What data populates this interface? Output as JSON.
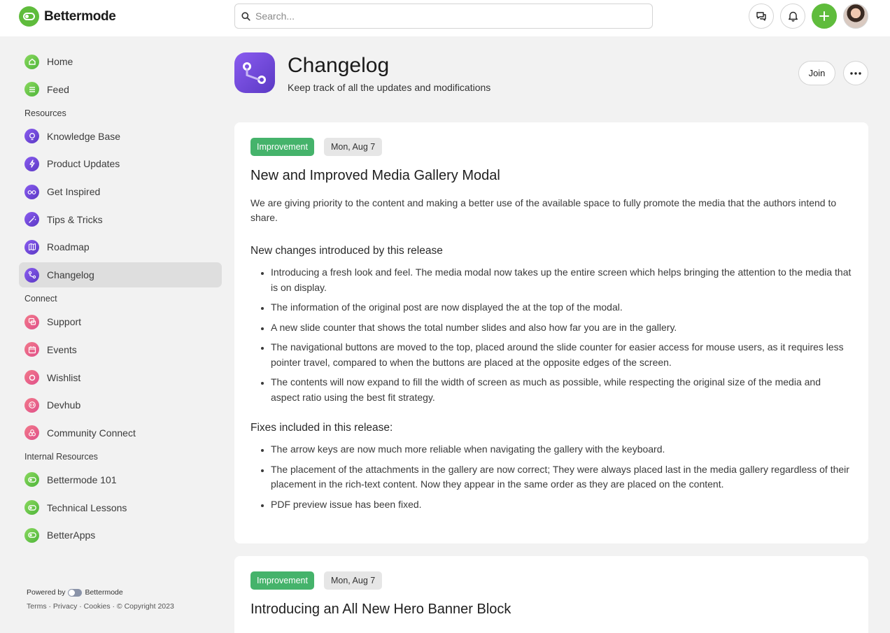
{
  "brand": {
    "name": "Bettermode"
  },
  "search": {
    "placeholder": "Search..."
  },
  "sidebar": {
    "main": [
      {
        "label": "Home",
        "icon": "home-icon",
        "color": "green"
      },
      {
        "label": "Feed",
        "icon": "list-icon",
        "color": "green"
      }
    ],
    "sections": [
      {
        "title": "Resources",
        "items": [
          {
            "label": "Knowledge Base",
            "icon": "lightbulb-icon",
            "color": "purple"
          },
          {
            "label": "Product Updates",
            "icon": "lightning-icon",
            "color": "purple"
          },
          {
            "label": "Get Inspired",
            "icon": "glasses-icon",
            "color": "purple"
          },
          {
            "label": "Tips & Tricks",
            "icon": "wand-icon",
            "color": "purple"
          },
          {
            "label": "Roadmap",
            "icon": "map-icon",
            "color": "purple"
          },
          {
            "label": "Changelog",
            "icon": "git-branch-icon",
            "color": "purple",
            "active": true
          }
        ]
      },
      {
        "title": "Connect",
        "items": [
          {
            "label": "Support",
            "icon": "chat-icon",
            "color": "pink"
          },
          {
            "label": "Events",
            "icon": "calendar-icon",
            "color": "pink"
          },
          {
            "label": "Wishlist",
            "icon": "circle-icon",
            "color": "pink"
          },
          {
            "label": "Devhub",
            "icon": "code-icon",
            "color": "pink"
          },
          {
            "label": "Community Connect",
            "icon": "community-icon",
            "color": "pink"
          }
        ]
      },
      {
        "title": "Internal Resources",
        "items": [
          {
            "label": "Bettermode 101",
            "icon": "bettermode-icon",
            "color": "green"
          },
          {
            "label": "Technical Lessons",
            "icon": "bettermode-icon",
            "color": "green"
          },
          {
            "label": "BetterApps",
            "icon": "bettermode-icon",
            "color": "green"
          }
        ]
      }
    ],
    "powered_by": "Powered by",
    "powered_brand": "Bettermode",
    "footer": "Terms · Privacy · Cookies · © Copyright 2023"
  },
  "space": {
    "title": "Changelog",
    "subtitle": "Keep track of all the updates and modifications",
    "join_label": "Join"
  },
  "posts": [
    {
      "tag": "Improvement",
      "date": "Mon, Aug 7",
      "title": "New and Improved Media Gallery Modal",
      "intro": "We are giving priority to the content and making a better use of the available space to fully promote the media that the authors intend to share.",
      "section1_title": "New changes introduced by this release",
      "section1_items": [
        "Introducing a fresh look and feel. The media modal now takes up the entire screen which helps bringing the attention to the media that is on display.",
        "The information of the original post are now displayed the at the top of the modal.",
        "A new slide counter that shows the total number slides and also how far you are in the gallery.",
        "The navigational buttons are moved to the top, placed around the slide counter for easier access for mouse users, as it requires less pointer travel, compared to when the buttons are placed at the opposite edges of the screen.",
        "The contents will now expand to fill the width of screen as much as possible, while respecting the original size of the media and aspect ratio using the best fit strategy."
      ],
      "section2_title": "Fixes included in this release:",
      "section2_items": [
        "The arrow keys are now much more reliable when navigating the gallery with the keyboard.",
        "The placement of the attachments in the gallery are now correct; They were always placed last in the media gallery regardless of their placement in the rich-text content. Now they appear in the same order as they are placed on the content.",
        "PDF preview issue has been fixed."
      ]
    },
    {
      "tag": "Improvement",
      "date": "Mon, Aug 7",
      "title": "Introducing an All New Hero Banner Block"
    }
  ],
  "colors": {
    "brand_green": "#5fbc3c",
    "tag_green": "#45b36b",
    "purple": "#6a45d8",
    "pink": "#e8608a"
  }
}
